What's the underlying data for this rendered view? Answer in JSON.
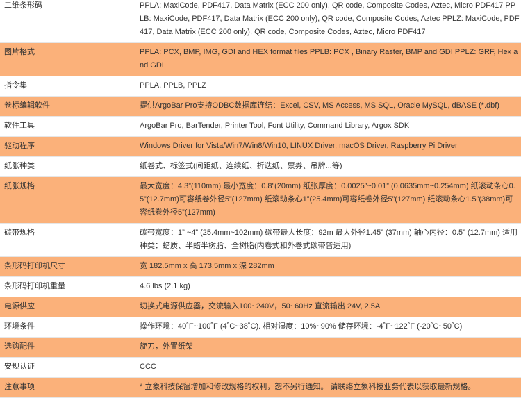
{
  "rows": [
    {
      "label": "二维条形码",
      "value": "PPLA: MaxiCode, PDF417, Data Matrix (ECC 200 only), QR code, Composite Codes, Aztec, Micro PDF417 PPLB: MaxiCode, PDF417, Data Matrix (ECC 200 only), QR code, Composite Codes, Aztec PPLZ: MaxiCode, PDF417, Data Matrix (ECC 200 only), QR code, Composite Codes, Aztec, Micro PDF417"
    },
    {
      "label": "图片格式",
      "value": "PPLA: PCX, BMP, IMG, GDI and HEX format files PPLB: PCX , Binary Raster, BMP and GDI PPLZ: GRF, Hex and GDI"
    },
    {
      "label": "指令集",
      "value": "PPLA, PPLB, PPLZ"
    },
    {
      "label": "卷标编辑软件",
      "value": "提供ArgoBar Pro支持ODBC数据库连结：Excel, CSV, MS Access, MS SQL, Oracle MySQL, dBASE (*.dbf)"
    },
    {
      "label": "软件工具",
      "value": "ArgoBar Pro, BarTender, Printer Tool, Font Utility, Command Library, Argox SDK"
    },
    {
      "label": "驱动程序",
      "value": "Windows Driver for Vista/Win7/Win8/Win10, LINUX Driver, macOS Driver, Raspberry Pi Driver"
    },
    {
      "label": "纸张种类",
      "value": "纸卷式、标签式(间距纸、连续纸、折迭纸、票券、吊牌...等)"
    },
    {
      "label": "纸张规格",
      "value": "最大宽度：4.3”(110mm) 最小宽度：0.8”(20mm) 纸张厚度：0.0025”~0.01” (0.0635mm~0.254mm) 纸滚动条心0.5”(12.7mm)可容纸卷外径5”(127mm) 纸滚动条心1”(25.4mm)可容纸卷外径5”(127mm) 纸滚动条心1.5”(38mm)可容纸卷外径5”(127mm)"
    },
    {
      "label": "碳带规格",
      "value": "碳带宽度：1” ~4” (25.4mm~102mm) 碳带最大长度：92m 最大外径1.45” (37mm) 轴心内径：0.5” (12.7mm) 适用种类：蜡质、半蜡半树脂、全树脂(内卷式和外卷式碳带皆适用)"
    },
    {
      "label": "条形码打印机尺寸",
      "value": "宽 182.5mm x 高 173.5mm x 深 282mm"
    },
    {
      "label": "条形码打印机重量",
      "value": "4.6 lbs (2.1 kg)"
    },
    {
      "label": "电源供应",
      "value": "切换式电源供应器，交流输入100~240V，50~60Hz 直流输出 24V, 2.5A"
    },
    {
      "label": "环境条件",
      "value": "操作环境：40˚F~100˚F (4˚C~38˚C). 相对湿度：10%~90% 储存环境：-4˚F~122˚F (-20˚C~50˚C)"
    },
    {
      "label": "选购配件",
      "value": "旋刀，外置纸架"
    },
    {
      "label": "安规认证",
      "value": "CCC"
    },
    {
      "label": "注意事项",
      "value": "* 立象科技保留增加和修改规格的权利，恕不另行通知。 请联络立象科技业务代表以获取最新规格。"
    }
  ]
}
